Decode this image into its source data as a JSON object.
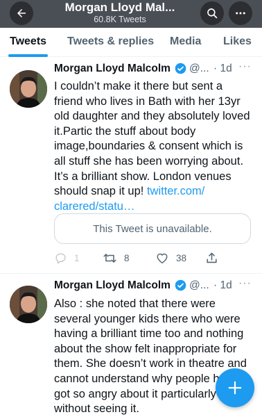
{
  "header": {
    "title": "Morgan Lloyd Mal...",
    "subtitle": "60.8K Tweets",
    "back_icon": "arrow-left-icon",
    "search_icon": "search-icon",
    "more_icon": "more-horizontal-icon",
    "background_color": "#4a4f56"
  },
  "tabs": [
    {
      "label": "Tweets",
      "active": true
    },
    {
      "label": "Tweets & replies",
      "active": false
    },
    {
      "label": "Media",
      "active": false
    },
    {
      "label": "Likes",
      "active": false
    }
  ],
  "tweets": [
    {
      "author": "Morgan Lloyd Malcolm",
      "handle": "@...",
      "time": "· 1d",
      "more": "···",
      "verified": true,
      "lines": [
        "I couldn’t make it there but sent a",
        "friend who lives in Bath with her 13yr",
        "old daughter and they absolutely loved",
        "it.Partic the stuff about body",
        "image,boundaries & consent which is",
        "all stuff she has been worrying about.",
        "It’s a brilliant show. London venues",
        "should snap it up!"
      ],
      "link_line1": "twitter.com/",
      "link_line2": "clarered/statu…",
      "quote_text": "This Tweet is unavailable.",
      "replies": "1",
      "retweets": "8",
      "likes": "38"
    },
    {
      "author": "Morgan Lloyd Malcolm",
      "handle": "@...",
      "time": "· 1d",
      "more": "···",
      "verified": true,
      "lines": [
        "Also : she noted that there were",
        "several younger kids there who were",
        "having a brilliant time too and nothing",
        "about the show felt inappropriate for",
        "them. She doesn’t work in theatre and",
        "cannot understand why people have",
        "got so angry about it particularly",
        "without seeing it."
      ]
    }
  ],
  "fab": {
    "icon": "compose-plus-icon"
  },
  "colors": {
    "accent": "#1d9bf0",
    "text": "#0f1419",
    "muted": "#536471"
  }
}
